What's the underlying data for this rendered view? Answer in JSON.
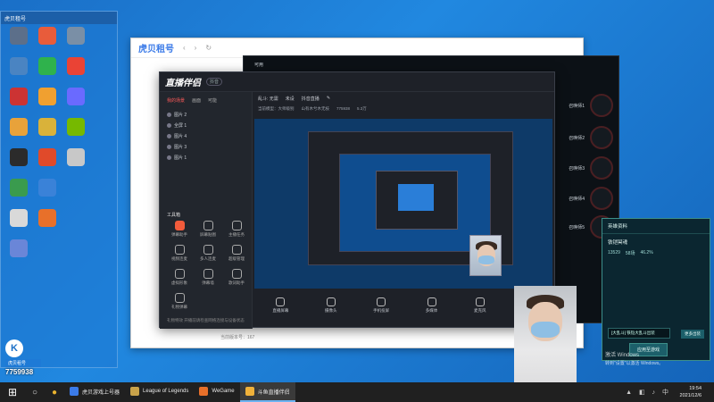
{
  "desktop": {
    "mini_panel_title": "虎贝租号",
    "mini_panel_stat": "16527",
    "icons_col1": [
      "",
      "",
      "",
      "",
      " ",
      "",
      "",
      "",
      "",
      ""
    ],
    "icons_col2": [
      "",
      "",
      "",
      "",
      "",
      "",
      "",
      "",
      "",
      ""
    ],
    "icons_col3": [
      "",
      "",
      "",
      "",
      "",
      "",
      "",
      "",
      "",
      ""
    ]
  },
  "browser": {
    "logo": "虎贝租号",
    "bottom_status": "当前版本号：167"
  },
  "game": {
    "left_label": "可用",
    "slot_labels": [
      "召唤师1",
      "召唤师2",
      "召唤师3",
      "召唤师4",
      "召唤师5"
    ]
  },
  "live": {
    "brand": "直播伴侣",
    "badge": "抖音",
    "tabs": [
      "我的场景",
      "画面",
      "可能"
    ],
    "sources": [
      "图片 2",
      "全屏 1",
      "图片 4",
      "图片 3",
      "图片 1"
    ],
    "tools_title": "工具箱",
    "tools": [
      "弹幕助手",
      "屏幕贴图",
      "主播任务",
      "视频连麦",
      "多人连麦",
      "超级管理",
      "虚拟形象",
      "弹幕墙",
      "歌词助手",
      "礼物弹幕",
      "",
      ""
    ],
    "meta": [
      "乱斗: 无需",
      "未设",
      "抖音直播",
      "✎"
    ],
    "meta2": [
      "当前模型：大师级别",
      "山有木兮木无枝",
      "775938",
      "5.3万"
    ],
    "controls": [
      "直播屏幕",
      "摄像头",
      "手机投屏",
      "多媒体",
      "麦克风",
      "扬声器"
    ],
    "footer": "礼物特效  开播前请检查网络连接与设备状态"
  },
  "hero": {
    "title": "英雄资料",
    "name": "铁铠冥魂",
    "stats": [
      "13529",
      "58场",
      "46.2%"
    ],
    "select": "[大乱斗] 铁铠大乱斗出装",
    "btn_small": "更多出装",
    "btn_main": "应用至游戏"
  },
  "activation": {
    "line1": "激活 Windows",
    "line2": "转到\"设置\"以激活 Windows。"
  },
  "badge": {
    "logo": "K",
    "name": "虎贝租号",
    "number": "7759938"
  },
  "taskbar": {
    "items": [
      {
        "label": "虎贝游戏上号器",
        "active": false
      },
      {
        "label": "League of Legends",
        "active": false
      },
      {
        "label": "WeGame",
        "active": false
      },
      {
        "label": "斗鱼直播伴侣",
        "active": true
      }
    ],
    "time": "19:54",
    "date": "2021/12/6"
  }
}
